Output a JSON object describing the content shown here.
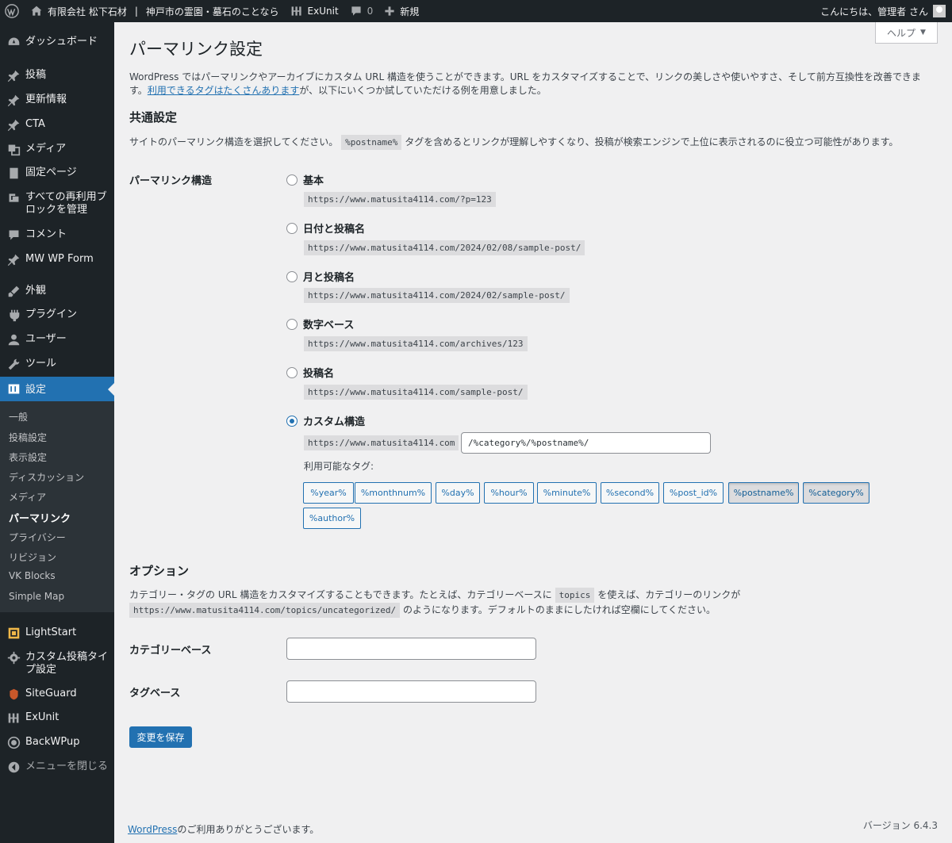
{
  "adminbar": {
    "site_name": "有限会社 松下石材",
    "separator": "|",
    "site_tagline": "神戸市の霊園・墓石のことなら",
    "exunit": "ExUnit",
    "comments_count": "0",
    "new_label": "新規",
    "greeting": "こんにちは、管理者 さん"
  },
  "sidebar": {
    "items": [
      {
        "label": "ダッシュボード",
        "icon": "dashboard-icon"
      },
      {
        "label": "投稿",
        "icon": "pin-icon"
      },
      {
        "label": "更新情報",
        "icon": "pin-icon"
      },
      {
        "label": "CTA",
        "icon": "pin-icon"
      },
      {
        "label": "メディア",
        "icon": "media-icon"
      },
      {
        "label": "固定ページ",
        "icon": "page-icon"
      },
      {
        "label": "すべての再利用ブロックを管理",
        "icon": "reusable-block-icon"
      },
      {
        "label": "コメント",
        "icon": "comment-icon"
      },
      {
        "label": "MW WP Form",
        "icon": "pin-icon"
      },
      {
        "label": "外観",
        "icon": "brush-icon"
      },
      {
        "label": "プラグイン",
        "icon": "plugin-icon"
      },
      {
        "label": "ユーザー",
        "icon": "user-icon"
      },
      {
        "label": "ツール",
        "icon": "wrench-icon"
      },
      {
        "label": "設定",
        "icon": "settings-icon"
      },
      {
        "label": "LightStart",
        "icon": "lightstart-icon"
      },
      {
        "label": "カスタム投稿タイプ設定",
        "icon": "gear-icon"
      },
      {
        "label": "SiteGuard",
        "icon": "siteguard-icon"
      },
      {
        "label": "ExUnit",
        "icon": "exunit-icon"
      },
      {
        "label": "BackWPup",
        "icon": "backwpup-icon"
      },
      {
        "label": "メニューを閉じる",
        "icon": "collapse-icon"
      }
    ],
    "submenu": [
      "一般",
      "投稿設定",
      "表示設定",
      "ディスカッション",
      "メディア",
      "パーマリンク",
      "プライバシー",
      "リビジョン",
      "VK Blocks",
      "Simple Map"
    ]
  },
  "main": {
    "help": "ヘルプ",
    "title": "パーマリンク設定",
    "intro_text": "WordPress ではパーマリンクやアーカイブにカスタム URL 構造を使うことができます。URL をカスタマイズすることで、リンクの美しさや使いやすさ、そして前方互換性を改善できます。",
    "intro_link": "利用できるタグはたくさんあります",
    "intro_tail": "が、以下にいくつか試していただける例を用意しました。",
    "common_heading": "共通設定",
    "common_desc_pre": "サイトのパーマリンク構造を選択してください。",
    "common_desc_code": "%postname%",
    "common_desc_post": "タグを含めるとリンクが理解しやすくなり、投稿が検索エンジンで上位に表示されるのに役立つ可能性があります。",
    "structure_label": "パーマリンク構造",
    "options": [
      {
        "label": "基本",
        "sample": "https://www.matusita4114.com/?p=123",
        "checked": false
      },
      {
        "label": "日付と投稿名",
        "sample": "https://www.matusita4114.com/2024/02/08/sample-post/",
        "checked": false
      },
      {
        "label": "月と投稿名",
        "sample": "https://www.matusita4114.com/2024/02/sample-post/",
        "checked": false
      },
      {
        "label": "数字ベース",
        "sample": "https://www.matusita4114.com/archives/123",
        "checked": false
      },
      {
        "label": "投稿名",
        "sample": "https://www.matusita4114.com/sample-post/",
        "checked": false
      },
      {
        "label": "カスタム構造",
        "sample": "https://www.matusita4114.com",
        "checked": true
      }
    ],
    "custom_value": "/%category%/%postname%/",
    "available_tags_label": "利用可能なタグ:",
    "tags": [
      {
        "label": "%year%",
        "active": false
      },
      {
        "label": "%monthnum%",
        "active": false
      },
      {
        "label": "%day%",
        "active": false
      },
      {
        "label": "%hour%",
        "active": false
      },
      {
        "label": "%minute%",
        "active": false
      },
      {
        "label": "%second%",
        "active": false
      },
      {
        "label": "%post_id%",
        "active": false
      },
      {
        "label": "%postname%",
        "active": true
      },
      {
        "label": "%category%",
        "active": true
      },
      {
        "label": "%author%",
        "active": false
      }
    ],
    "options_heading": "オプション",
    "options_desc_1_pre": "カテゴリー・タグの URL 構造をカスタマイズすることもできます。たとえば、カテゴリーベースに",
    "options_desc_1_code": "topics",
    "options_desc_1_post": "を使えば、カテゴリーのリンクが",
    "options_desc_2_code": "https://www.matusita4114.com/topics/uncategorized/",
    "options_desc_2_post": "のようになります。デフォルトのままにしたければ空欄にしてください。",
    "category_base_label": "カテゴリーベース",
    "category_base_value": "",
    "tag_base_label": "タグベース",
    "tag_base_value": "",
    "save_label": "変更を保存"
  },
  "footer": {
    "link": "WordPress",
    "thanks": "のご利用ありがとうございます。",
    "version": "バージョン 6.4.3"
  },
  "colors": {
    "accent": "#2271b1",
    "sidebar_bg": "#1d2327",
    "submenu_bg": "#2c3338",
    "page_bg": "#f0f0f1"
  }
}
